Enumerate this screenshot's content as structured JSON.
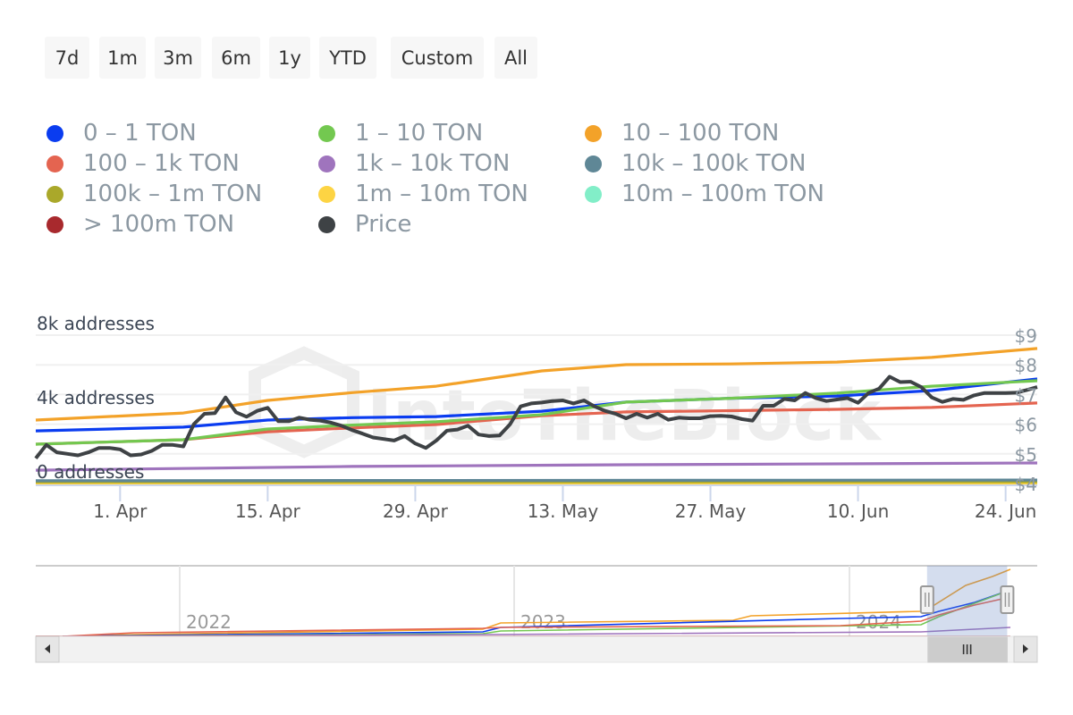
{
  "range_buttons": [
    "7d",
    "1m",
    "3m",
    "6m",
    "1y",
    "YTD",
    "Custom",
    "All"
  ],
  "legend": [
    {
      "label": "0 – 1 TON",
      "color": "#0a3cf0"
    },
    {
      "label": "1 – 10 TON",
      "color": "#73c850"
    },
    {
      "label": "10 – 100 TON",
      "color": "#f3a229"
    },
    {
      "label": "100 – 1k TON",
      "color": "#e46450"
    },
    {
      "label": "1k – 10k TON",
      "color": "#9f74bd"
    },
    {
      "label": "10k – 100k TON",
      "color": "#5f8796"
    },
    {
      "label": "100k – 1m TON",
      "color": "#aaa82a"
    },
    {
      "label": "1m – 10m TON",
      "color": "#fdd443"
    },
    {
      "label": "10m – 100m TON",
      "color": "#82eec8"
    },
    {
      "label": "> 100m TON",
      "color": "#a8292d"
    },
    {
      "label": "Price",
      "color": "#3e4245"
    }
  ],
  "watermark": "IntoTheBlock",
  "chart_data": {
    "type": "line",
    "title": "",
    "x_start": "2024-03-24",
    "x_end": "2024-06-27",
    "x_ticks": [
      "1. Apr",
      "15. Apr",
      "29. Apr",
      "13. May",
      "27. May",
      "10. Jun",
      "24. Jun"
    ],
    "x_tick_days": [
      8,
      22,
      36,
      50,
      64,
      78,
      92
    ],
    "x_span_days": 95,
    "y_left": {
      "ticks": [
        "0 addresses",
        "4k addresses",
        "8k addresses"
      ],
      "tick_values": [
        0,
        4000,
        8000
      ],
      "range": [
        0,
        8000
      ]
    },
    "y_right": {
      "ticks": [
        "$4",
        "$5",
        "$6",
        "$7",
        "$8",
        "$9"
      ],
      "tick_values": [
        4,
        5,
        6,
        7,
        8,
        9
      ],
      "range": [
        4,
        9
      ]
    },
    "grid": true,
    "legend_position": "top",
    "series": [
      {
        "name": "10 – 100 TON",
        "axis": "left",
        "color": "#f3a229",
        "x": [
          0,
          14,
          22,
          30,
          38,
          48,
          56,
          66,
          76,
          85,
          95
        ],
        "values": [
          3420,
          3800,
          4480,
          4900,
          5250,
          6070,
          6410,
          6450,
          6550,
          6800,
          7280
        ]
      },
      {
        "name": "0 – 1 TON",
        "axis": "left",
        "color": "#0a3cf0",
        "x": [
          0,
          14,
          22,
          30,
          38,
          48,
          56,
          66,
          76,
          85,
          95
        ],
        "values": [
          2840,
          3040,
          3420,
          3550,
          3610,
          3900,
          4390,
          4600,
          4720,
          5010,
          5640
        ]
      },
      {
        "name": "1 – 10 TON",
        "axis": "left",
        "color": "#73c850",
        "x": [
          0,
          14,
          22,
          30,
          38,
          48,
          56,
          66,
          76,
          85,
          95
        ],
        "values": [
          2120,
          2360,
          2940,
          3150,
          3330,
          3710,
          4390,
          4600,
          4870,
          5250,
          5540
        ]
      },
      {
        "name": "100 – 1k TON",
        "axis": "left",
        "color": "#e46450",
        "x": [
          0,
          14,
          22,
          30,
          38,
          48,
          56,
          66,
          76,
          85,
          95
        ],
        "values": [
          2120,
          2360,
          2790,
          3000,
          3180,
          3660,
          3860,
          3930,
          4000,
          4100,
          4340
        ]
      },
      {
        "name": "1k – 10k TON",
        "axis": "left",
        "color": "#9f74bd",
        "x": [
          0,
          30,
          56,
          95
        ],
        "values": [
          720,
          920,
          1010,
          1110
        ]
      },
      {
        "name": "10k – 100k TON",
        "axis": "left",
        "color": "#5f8796",
        "x": [
          0,
          95
        ],
        "values": [
          150,
          190
        ]
      },
      {
        "name": "100k – 1m TON",
        "axis": "left",
        "color": "#aaa82a",
        "x": [
          0,
          95
        ],
        "values": [
          90,
          100
        ]
      },
      {
        "name": "1m – 10m TON",
        "axis": "left",
        "color": "#fdd443",
        "x": [
          0,
          95
        ],
        "values": [
          20,
          25
        ]
      },
      {
        "name": "10m – 100m TON",
        "axis": "left",
        "color": "#82eec8",
        "x": [
          0,
          95
        ],
        "values": [
          10,
          12
        ]
      },
      {
        "name": "> 100m TON",
        "axis": "left",
        "color": "#a8292d",
        "x": [
          0,
          95
        ],
        "values": [
          40,
          50
        ]
      },
      {
        "name": "Price",
        "axis": "right",
        "color": "#3e4245",
        "x": [
          0,
          1,
          2,
          3,
          4,
          5,
          6,
          7,
          8,
          9,
          10,
          11,
          12,
          13,
          14,
          15,
          16,
          17,
          18,
          19,
          20,
          21,
          22,
          23,
          24,
          25,
          26,
          27,
          28,
          29,
          30,
          31,
          32,
          33,
          34,
          35,
          36,
          37,
          38,
          39,
          40,
          41,
          42,
          43,
          44,
          45,
          46,
          47,
          48,
          49,
          50,
          51,
          52,
          53,
          54,
          55,
          56,
          57,
          58,
          59,
          60,
          61,
          62,
          63,
          64,
          65,
          66,
          67,
          68,
          69,
          70,
          71,
          72,
          73,
          74,
          75,
          76,
          77,
          78,
          79,
          80,
          81,
          82,
          83,
          84,
          85,
          86,
          87,
          88,
          89,
          90,
          91,
          92,
          93,
          94,
          95
        ],
        "values": [
          4.85,
          5.3,
          5.05,
          5.0,
          4.95,
          5.05,
          5.2,
          5.2,
          5.15,
          4.95,
          4.98,
          5.1,
          5.3,
          5.3,
          5.25,
          6.0,
          6.35,
          6.37,
          6.9,
          6.4,
          6.25,
          6.45,
          6.55,
          6.1,
          6.1,
          6.22,
          6.15,
          6.12,
          6.05,
          5.95,
          5.8,
          5.68,
          5.55,
          5.5,
          5.45,
          5.6,
          5.35,
          5.2,
          5.45,
          5.78,
          5.82,
          5.95,
          5.65,
          5.6,
          5.62,
          6.0,
          6.6,
          6.7,
          6.73,
          6.78,
          6.8,
          6.7,
          6.8,
          6.6,
          6.45,
          6.35,
          6.2,
          6.35,
          6.22,
          6.35,
          6.15,
          6.22,
          6.2,
          6.2,
          6.27,
          6.28,
          6.26,
          6.17,
          6.12,
          6.62,
          6.62,
          6.85,
          6.8,
          7.05,
          6.88,
          6.78,
          6.83,
          6.88,
          6.72,
          7.05,
          7.2,
          7.6,
          7.42,
          7.43,
          7.25,
          6.9,
          6.75,
          6.85,
          6.82,
          6.97,
          7.05,
          7.05,
          7.05,
          7.06,
          7.15,
          7.25
        ]
      }
    ]
  },
  "navigator": {
    "year_labels": [
      "2022",
      "2023",
      "2024"
    ],
    "selected_range_fraction": [
      0.89,
      0.97
    ]
  }
}
